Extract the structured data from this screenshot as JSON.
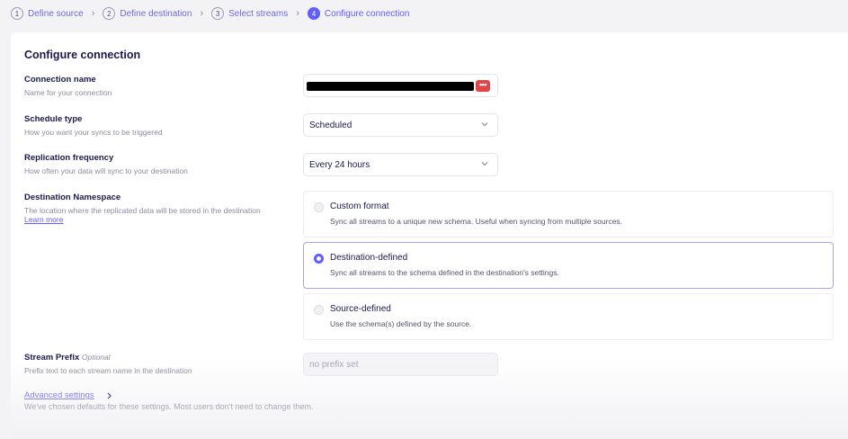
{
  "stepper": {
    "steps": [
      {
        "num": "1",
        "label": "Define source"
      },
      {
        "num": "2",
        "label": "Define destination"
      },
      {
        "num": "3",
        "label": "Select streams"
      },
      {
        "num": "4",
        "label": "Configure connection"
      }
    ],
    "separator": "›",
    "active_index": 3
  },
  "card": {
    "title": "Configure connection",
    "connection_name": {
      "label": "Connection name",
      "description": "Name for your connection",
      "icon": "password-manager-icon"
    },
    "schedule_type": {
      "label": "Schedule type",
      "description": "How you want your syncs to be triggered",
      "value": "Scheduled"
    },
    "replication_frequency": {
      "label": "Replication frequency",
      "description": "How often your data will sync to your destination",
      "value": "Every 24 hours"
    },
    "destination_namespace": {
      "label": "Destination Namespace",
      "description": "The location where the replicated data will be stored in the destination",
      "learn_more": "Learn more",
      "selected": "destination-defined",
      "options": [
        {
          "id": "custom-format",
          "title": "Custom format",
          "description": "Sync all streams to a unique new schema. Useful when syncing from multiple sources."
        },
        {
          "id": "destination-defined",
          "title": "Destination-defined",
          "description": "Sync all streams to the schema defined in the destination's settings."
        },
        {
          "id": "source-defined",
          "title": "Source-defined",
          "description": "Use the schema(s) defined by the source."
        }
      ]
    },
    "stream_prefix": {
      "label": "Stream Prefix",
      "optional": "Optional",
      "description": "Prefix text to each stream name in the destination",
      "placeholder": "no prefix set"
    },
    "advanced": {
      "link": "Advanced settings",
      "description": "We've chosen defaults for these settings. Most users don't need to change them."
    }
  },
  "colors": {
    "accent": "#615eff",
    "text": "#1a194d",
    "muted": "#8b8ba0",
    "danger": "#e34446"
  }
}
